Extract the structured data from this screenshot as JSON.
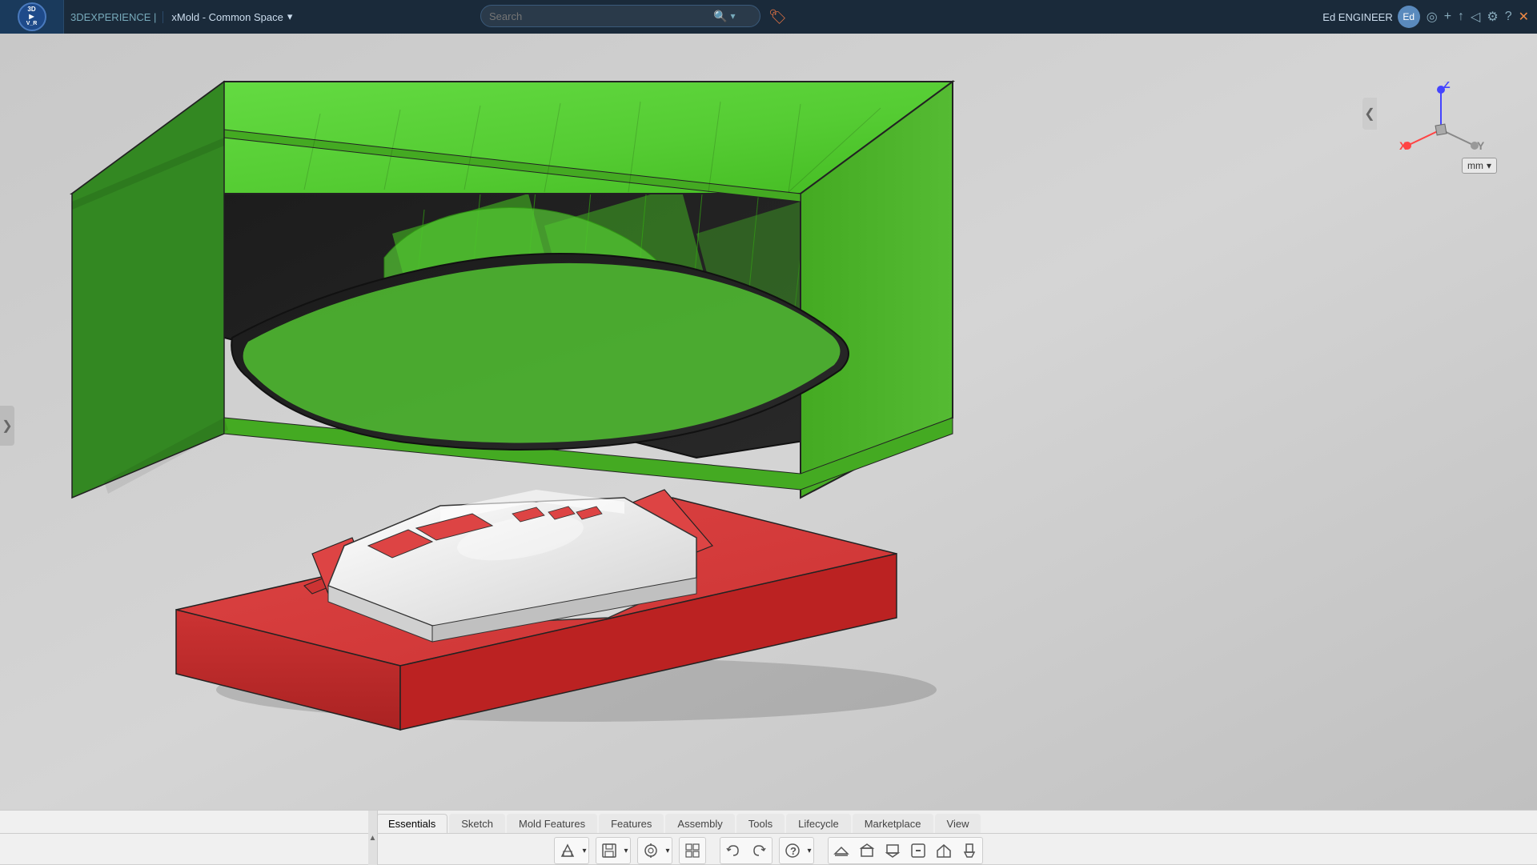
{
  "topbar": {
    "app_name": "3D",
    "logo_text": "3D\n▶\nV_R",
    "experience_label": "3DEXPERIENCE |",
    "workspace": "xMold - Common Space",
    "workspace_dropdown": "▾",
    "search_placeholder": "Search",
    "bookmark_icon": "🏷",
    "user_label": "Ed ENGINEER",
    "icons": [
      "▷",
      "+",
      "⤴",
      "◀",
      "⚙",
      "?",
      "✕"
    ]
  },
  "viewport": {
    "units": "mm",
    "units_dropdown": "▾"
  },
  "bottom_toolbar": {
    "tabs": [
      {
        "label": "Essentials",
        "active": false
      },
      {
        "label": "Sketch",
        "active": false
      },
      {
        "label": "Mold Features",
        "active": false
      },
      {
        "label": "Features",
        "active": false
      },
      {
        "label": "Assembly",
        "active": false
      },
      {
        "label": "Tools",
        "active": false
      },
      {
        "label": "Lifecycle",
        "active": false
      },
      {
        "label": "Marketplace",
        "active": false
      },
      {
        "label": "View",
        "active": false
      }
    ],
    "tools": [
      "⬡",
      "💾",
      "⚙",
      "↺",
      "↻",
      "❓",
      "◈",
      "◉",
      "▦",
      "⬜",
      "⬛",
      "◼"
    ]
  },
  "left_toggle": "❯",
  "right_collapse": "❮"
}
